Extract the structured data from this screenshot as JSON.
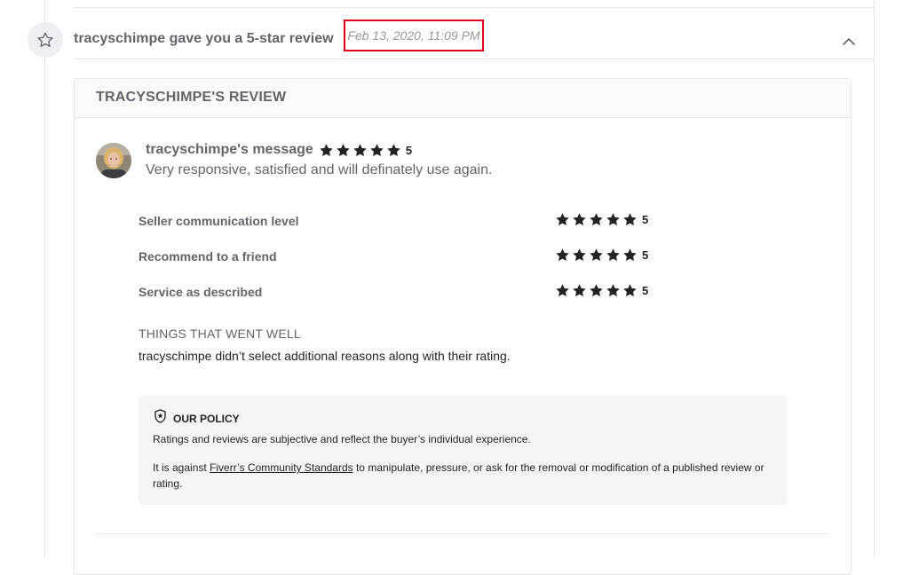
{
  "event": {
    "title": "tracyschimpe gave you a 5-star review",
    "timestamp": "Feb 13, 2020, 11:09 PM",
    "icon": "star-outline-icon",
    "collapse_icon": "chevron-up-icon"
  },
  "review": {
    "heading": "TRACYSCHIMPE'S REVIEW",
    "author_label": "tracyschimpe's message",
    "overall_rating": "5",
    "overall_stars": 5,
    "message": "Very responsive, satisfied and will definately use again.",
    "criteria": [
      {
        "label": "Seller communication level",
        "rating": "5",
        "stars": 5
      },
      {
        "label": "Recommend to a friend",
        "rating": "5",
        "stars": 5
      },
      {
        "label": "Service as described",
        "rating": "5",
        "stars": 5
      }
    ],
    "went_well_title": "THINGS THAT WENT WELL",
    "went_well_text": "tracyschimpe didn’t select additional reasons along with their rating."
  },
  "policy": {
    "title": "OUR POLICY",
    "icon": "shield-star-icon",
    "p1": "Ratings and reviews are subjective and reflect the buyer’s individual experience.",
    "p2_before": "It is against ",
    "p2_link": "Fiverr’s Community Standards",
    "p2_after": " to manipulate, pressure, or ask for the removal or modification of a published review or rating."
  },
  "colors": {
    "star": "#222325",
    "timestamp_box": "#e0001c",
    "badge_bg": "#eeeff3"
  }
}
